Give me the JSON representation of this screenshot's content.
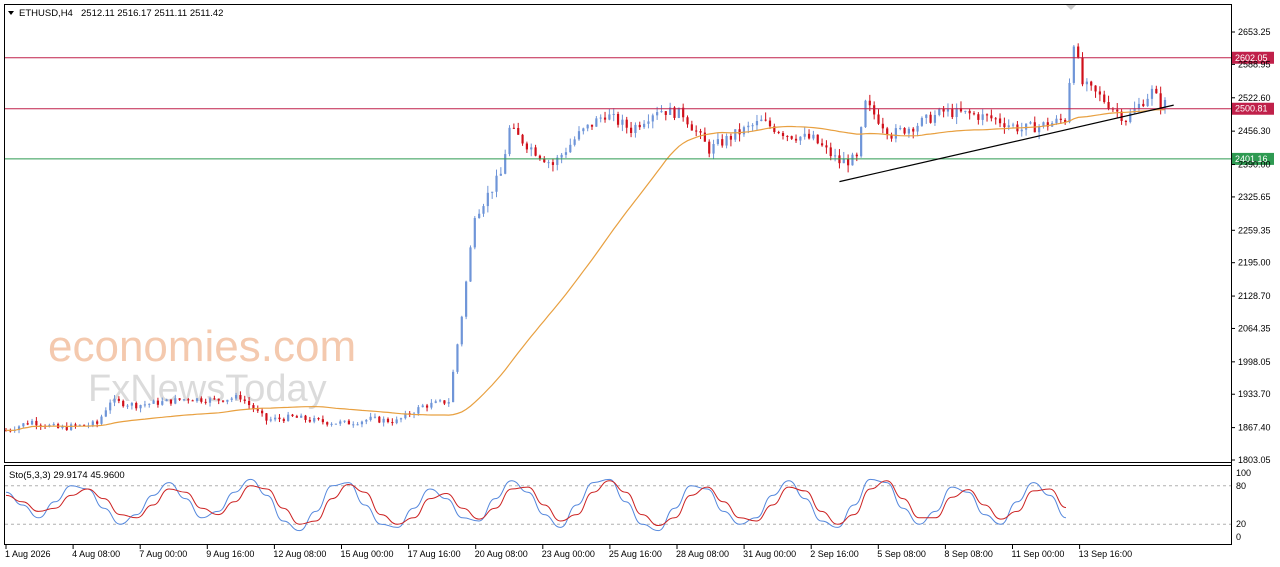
{
  "header": {
    "symbol": "ETHUSD,H4",
    "ohlc": "2512.11 2516.17 2511.11 2511.42",
    "dropdown_icon": "triangle-down-icon"
  },
  "watermark": {
    "line1": "economies.com",
    "line2": "FxNewsToday"
  },
  "colors": {
    "bull": "#6f95d8",
    "bear": "#d0101a",
    "ma": "#e8a040",
    "resistance": "#c0204a",
    "support": "#2e9a52",
    "stoch_k": "#5588dd",
    "stoch_d": "#cc2222",
    "trendline": "#000000"
  },
  "chart_data": [
    {
      "type": "candlestick",
      "symbol": "ETHUSD",
      "timeframe": "H4",
      "y_ticks": [
        "2653.25",
        "2588.95",
        "2522.60",
        "2456.30",
        "2390.00",
        "2325.65",
        "2259.35",
        "2195.00",
        "2128.70",
        "2064.35",
        "1998.05",
        "1933.70",
        "1867.40",
        "1803.05"
      ],
      "y_range": [
        1803.05,
        2653.25
      ],
      "x_ticks": [
        "1 Aug 2026",
        "4 Aug 08:00",
        "7 Aug 00:00",
        "9 Aug 16:00",
        "12 Aug 08:00",
        "15 Aug 00:00",
        "17 Aug 16:00",
        "20 Aug 08:00",
        "23 Aug 00:00",
        "25 Aug 16:00",
        "28 Aug 08:00",
        "31 Aug 00:00",
        "2 Sep 16:00",
        "5 Sep 08:00",
        "8 Sep 08:00",
        "11 Sep 00:00",
        "13 Sep 16:00"
      ],
      "horizontal_levels": [
        {
          "label": "2602.05",
          "value": 2602.05,
          "kind": "resistance"
        },
        {
          "label": "2500.81",
          "value": 2500.81,
          "kind": "resistance"
        },
        {
          "label": "2401.16",
          "value": 2401.16,
          "kind": "support"
        }
      ],
      "trendline": {
        "from": {
          "x": "2 Sep 00:00",
          "y": 2356
        },
        "to": {
          "x": "14 Sep 20:00",
          "y": 2508
        }
      },
      "moving_average": "orange",
      "price_path": [
        {
          "x": "1 Aug 00:00",
          "y": 1862
        },
        {
          "x": "2 Aug 00:00",
          "y": 1880
        },
        {
          "x": "3 Aug 00:00",
          "y": 1866
        },
        {
          "x": "4 Aug 00:00",
          "y": 1872
        },
        {
          "x": "4 Aug 12:00",
          "y": 1875
        },
        {
          "x": "5 Aug 00:00",
          "y": 1920
        },
        {
          "x": "6 Aug 00:00",
          "y": 1912
        },
        {
          "x": "7 Aug 00:00",
          "y": 1918
        },
        {
          "x": "8 Aug 00:00",
          "y": 1925
        },
        {
          "x": "9 Aug 00:00",
          "y": 1922
        },
        {
          "x": "10 Aug 00:00",
          "y": 1928
        },
        {
          "x": "11 Aug 00:00",
          "y": 1882
        },
        {
          "x": "12 Aug 00:00",
          "y": 1888
        },
        {
          "x": "13 Aug 00:00",
          "y": 1880
        },
        {
          "x": "14 Aug 00:00",
          "y": 1876
        },
        {
          "x": "15 Aug 00:00",
          "y": 1884
        },
        {
          "x": "16 Aug 00:00",
          "y": 1880
        },
        {
          "x": "17 Aug 00:00",
          "y": 1910
        },
        {
          "x": "18 Aug 00:00",
          "y": 1920
        },
        {
          "x": "18 Aug 12:00",
          "y": 2090
        },
        {
          "x": "19 Aug 00:00",
          "y": 2290
        },
        {
          "x": "20 Aug 00:00",
          "y": 2370
        },
        {
          "x": "20 Aug 08:00",
          "y": 2460
        },
        {
          "x": "21 Aug 00:00",
          "y": 2430
        },
        {
          "x": "22 Aug 00:00",
          "y": 2390
        },
        {
          "x": "23 Aug 00:00",
          "y": 2450
        },
        {
          "x": "24 Aug 00:00",
          "y": 2490
        },
        {
          "x": "25 Aug 00:00",
          "y": 2460
        },
        {
          "x": "26 Aug 00:00",
          "y": 2500
        },
        {
          "x": "27 Aug 00:00",
          "y": 2490
        },
        {
          "x": "28 Aug 00:00",
          "y": 2420
        },
        {
          "x": "29 Aug 00:00",
          "y": 2450
        },
        {
          "x": "30 Aug 00:00",
          "y": 2475
        },
        {
          "x": "31 Aug 00:00",
          "y": 2450
        },
        {
          "x": "1 Sep 00:00",
          "y": 2440
        },
        {
          "x": "2 Sep 00:00",
          "y": 2395
        },
        {
          "x": "2 Sep 16:00",
          "y": 2400
        },
        {
          "x": "3 Sep 00:00",
          "y": 2510
        },
        {
          "x": "4 Sep 00:00",
          "y": 2450
        },
        {
          "x": "5 Sep 00:00",
          "y": 2470
        },
        {
          "x": "6 Sep 00:00",
          "y": 2495
        },
        {
          "x": "7 Sep 00:00",
          "y": 2490
        },
        {
          "x": "8 Sep 00:00",
          "y": 2480
        },
        {
          "x": "9 Sep 00:00",
          "y": 2460
        },
        {
          "x": "10 Sep 00:00",
          "y": 2470
        },
        {
          "x": "10 Sep 16:00",
          "y": 2480
        },
        {
          "x": "11 Sep 00:00",
          "y": 2635
        },
        {
          "x": "11 Sep 08:00",
          "y": 2550
        },
        {
          "x": "12 Sep 00:00",
          "y": 2525
        },
        {
          "x": "13 Sep 00:00",
          "y": 2480
        },
        {
          "x": "14 Sep 00:00",
          "y": 2535
        },
        {
          "x": "14 Sep 08:00",
          "y": 2511
        }
      ]
    },
    {
      "type": "line",
      "indicator": "Stochastic",
      "label": "Sto(5,3,3) 29.9174 45.9600",
      "y_ticks": [
        "100",
        "80",
        "20",
        "0"
      ],
      "y_range": [
        0,
        100
      ],
      "levels": [
        80,
        20
      ],
      "series": [
        {
          "name": "%K",
          "values": [
            70,
            50,
            30,
            55,
            80,
            75,
            45,
            20,
            35,
            65,
            85,
            60,
            30,
            40,
            70,
            90,
            65,
            25,
            10,
            40,
            80,
            85,
            50,
            20,
            15,
            45,
            75,
            60,
            30,
            25,
            60,
            88,
            70,
            35,
            15,
            50,
            85,
            90,
            55,
            20,
            10,
            45,
            80,
            75,
            40,
            20,
            30,
            65,
            88,
            60,
            25,
            15,
            50,
            90,
            85,
            45,
            20,
            40,
            78,
            70,
            35,
            20,
            55,
            85,
            65,
            30
          ]
        },
        {
          "name": "%D",
          "values": [
            65,
            55,
            40,
            45,
            65,
            75,
            60,
            35,
            30,
            50,
            75,
            70,
            45,
            35,
            55,
            80,
            75,
            45,
            20,
            25,
            60,
            82,
            70,
            35,
            20,
            30,
            60,
            68,
            45,
            28,
            45,
            75,
            78,
            50,
            25,
            35,
            70,
            88,
            70,
            35,
            18,
            30,
            65,
            78,
            55,
            30,
            25,
            50,
            78,
            72,
            40,
            20,
            35,
            75,
            88,
            60,
            30,
            30,
            62,
            74,
            50,
            28,
            40,
            72,
            75,
            46
          ]
        }
      ]
    }
  ]
}
